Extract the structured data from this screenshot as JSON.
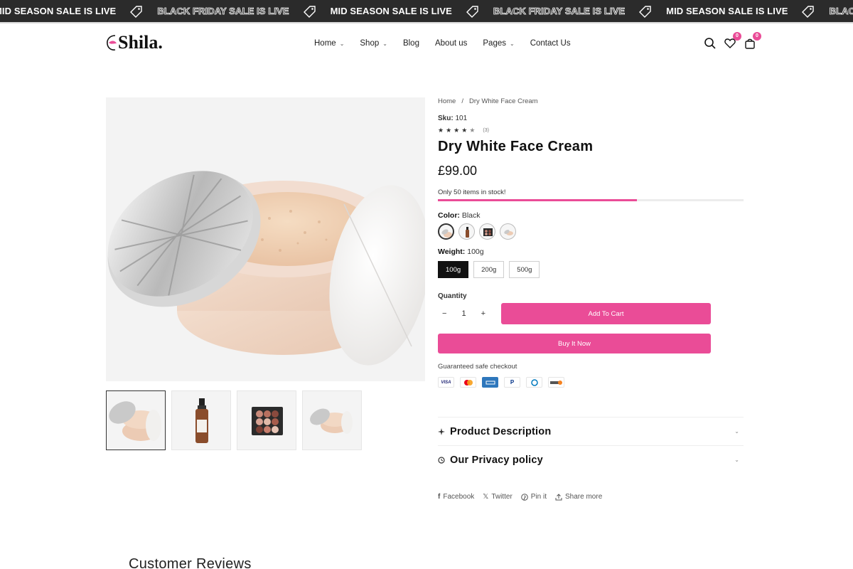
{
  "marquee": {
    "items": [
      {
        "text": "MID SEASON SALE IS LIVE",
        "style": "solid"
      },
      {
        "text": "BLACK FRIDAY SALE IS LIVE",
        "style": "outline"
      },
      {
        "text": "MID SEASON SALE IS LIVE",
        "style": "solid"
      },
      {
        "text": "BLACK FRIDAY SALE IS LIVE",
        "style": "outline"
      },
      {
        "text": "MID SEASON SALE IS LIVE",
        "style": "solid"
      },
      {
        "text": "BLACK FRIDAY",
        "style": "outline"
      }
    ],
    "icon": "price-tag-icon"
  },
  "header": {
    "logo": "Shila.",
    "nav": [
      {
        "label": "Home",
        "dropdown": true
      },
      {
        "label": "Shop",
        "dropdown": true
      },
      {
        "label": "Blog",
        "dropdown": false
      },
      {
        "label": "About us",
        "dropdown": false
      },
      {
        "label": "Pages",
        "dropdown": true
      },
      {
        "label": "Contact Us",
        "dropdown": false
      }
    ],
    "wishlist_count": "0",
    "cart_count": "0"
  },
  "breadcrumb": {
    "home": "Home",
    "separator": "/",
    "current": "Dry White Face Cream"
  },
  "product": {
    "sku_label": "Sku:",
    "sku": "101",
    "rating": 4.5,
    "review_count": "(3)",
    "title": "Dry White Face Cream",
    "price": "£99.00",
    "stock_text": "Only 50 items in stock!",
    "stock_fraction": 0.65,
    "color_label": "Color:",
    "color_value": "Black",
    "color_swatches": [
      "powder-jar",
      "serum-bottle",
      "eyeshadow-palette",
      "powder-jar-alt"
    ],
    "weight_label": "Weight:",
    "weight_value": "100g",
    "weights": [
      "100g",
      "200g",
      "500g"
    ],
    "quantity_label": "Quantity",
    "quantity": "1",
    "minus": "−",
    "plus": "+",
    "add_to_cart": "Add To Cart",
    "buy_now": "Buy It Now",
    "safe_checkout": "Guaranteed safe checkout",
    "payments": [
      "VISA",
      "mastercard",
      "amex",
      "paypal",
      "diners",
      "discover"
    ]
  },
  "accordions": [
    {
      "title": "Product Description",
      "icon": "sparkle-icon"
    },
    {
      "title": "Our Privacy policy",
      "icon": "clock-icon"
    }
  ],
  "share": [
    {
      "label": "Facebook",
      "icon": "facebook-icon"
    },
    {
      "label": "Twitter",
      "icon": "x-icon"
    },
    {
      "label": "Pin it",
      "icon": "pinterest-icon"
    },
    {
      "label": "Share more",
      "icon": "share-icon"
    }
  ],
  "reviews": {
    "title": "Customer Reviews"
  },
  "colors": {
    "accent": "#ea4c97",
    "marquee_bg": "#2b2b2b",
    "text": "#111111"
  }
}
